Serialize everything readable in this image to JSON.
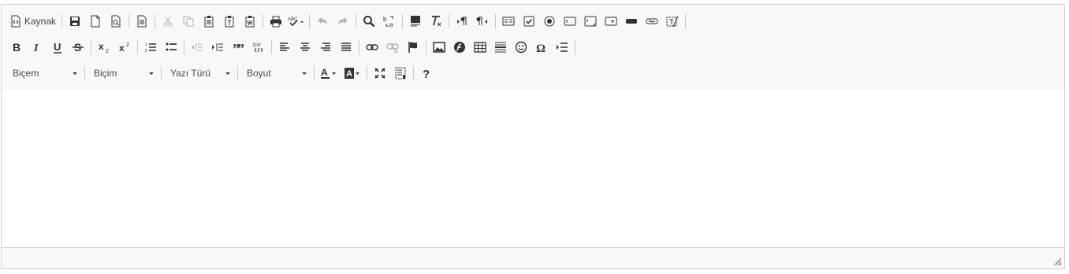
{
  "toolbar": {
    "source_label": "Kaynak",
    "styles_label": "Biçem",
    "format_label": "Biçim",
    "font_label": "Yazı Türü",
    "size_label": "Boyut"
  },
  "colors": {
    "toolbar_bg": "#f8f8f8",
    "border": "#d1d1d1",
    "icon": "#333333"
  }
}
